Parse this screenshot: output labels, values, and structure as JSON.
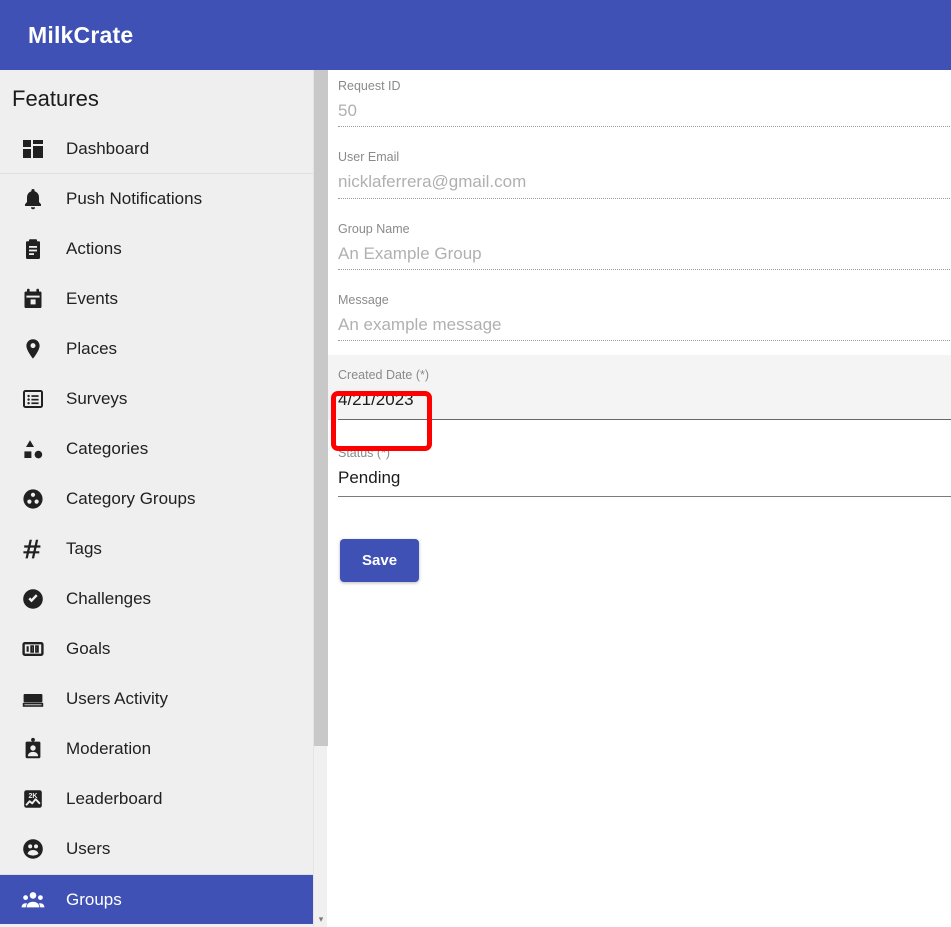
{
  "app": {
    "brand": "MilkCrate",
    "brand_color": "#3f51b5"
  },
  "sidebar": {
    "heading": "Features",
    "active_item": "Groups",
    "active_bg": "#3f51b5",
    "background": "#efefef",
    "items": [
      {
        "label": "Dashboard",
        "icon": "dashboard-icon"
      },
      {
        "label": "Push Notifications",
        "icon": "bell-icon"
      },
      {
        "label": "Actions",
        "icon": "clipboard-icon"
      },
      {
        "label": "Events",
        "icon": "calendar-icon"
      },
      {
        "label": "Places",
        "icon": "map-pin-icon"
      },
      {
        "label": "Surveys",
        "icon": "list-box-icon"
      },
      {
        "label": "Categories",
        "icon": "shapes-icon"
      },
      {
        "label": "Category Groups",
        "icon": "circle-dots-icon"
      },
      {
        "label": "Tags",
        "icon": "hash-icon"
      },
      {
        "label": "Challenges",
        "icon": "check-circle-icon"
      },
      {
        "label": "Goals",
        "icon": "hundred-icon"
      },
      {
        "label": "Users Activity",
        "icon": "bar-block-icon"
      },
      {
        "label": "Moderation",
        "icon": "badge-person-icon"
      },
      {
        "label": "Leaderboard",
        "icon": "chart-2k-icon"
      },
      {
        "label": "Users",
        "icon": "users-circle-icon"
      },
      {
        "label": "Groups",
        "icon": "group-people-icon"
      }
    ]
  },
  "scrollbar": {
    "arrow_glyph": "▾"
  },
  "form": {
    "fields": [
      {
        "label": "Request ID",
        "value": "50",
        "state": "disabled"
      },
      {
        "label": "User Email",
        "value": "nicklaferrera@gmail.com",
        "state": "disabled"
      },
      {
        "label": "Group Name",
        "value": "An Example Group",
        "state": "disabled"
      },
      {
        "label": "Message",
        "value": "An example message",
        "state": "disabled"
      },
      {
        "label": "Created Date (*)",
        "value": "4/21/2023",
        "state": "filled"
      },
      {
        "label": "Status (*)",
        "value": "Pending",
        "state": "editable"
      }
    ],
    "save_label": "Save",
    "save_color": "#3f51b5"
  },
  "annotation": {
    "color": "#fe0000",
    "target": "status-field"
  }
}
